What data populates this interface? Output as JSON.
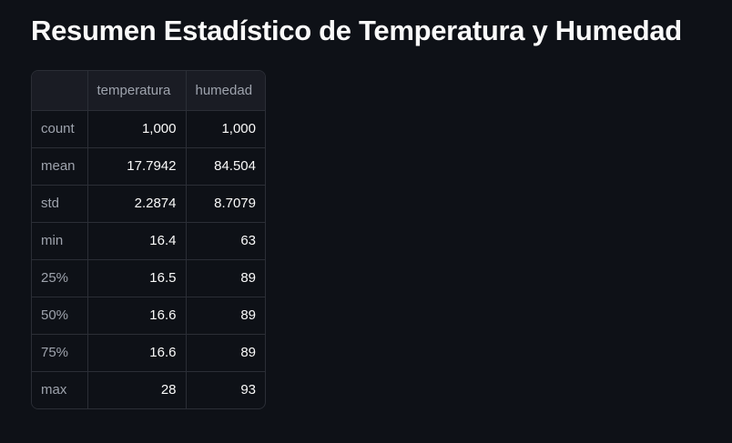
{
  "title": "Resumen Estadístico de Temperatura y Humedad",
  "table": {
    "columns": [
      "",
      "temperatura",
      "humedad"
    ],
    "rows": [
      {
        "label": "count",
        "temperatura": "1,000",
        "humedad": "1,000"
      },
      {
        "label": "mean",
        "temperatura": "17.7942",
        "humedad": "84.504"
      },
      {
        "label": "std",
        "temperatura": "2.2874",
        "humedad": "8.7079"
      },
      {
        "label": "min",
        "temperatura": "16.4",
        "humedad": "63"
      },
      {
        "label": "25%",
        "temperatura": "16.5",
        "humedad": "89"
      },
      {
        "label": "50%",
        "temperatura": "16.6",
        "humedad": "89"
      },
      {
        "label": "75%",
        "temperatura": "16.6",
        "humedad": "89"
      },
      {
        "label": "max",
        "temperatura": "28",
        "humedad": "93"
      }
    ]
  },
  "colors": {
    "background": "#0e1117",
    "header_background": "#1a1c24",
    "border": "#2b2e36",
    "text": "#fafafa",
    "muted_text": "#9ea3ad"
  }
}
